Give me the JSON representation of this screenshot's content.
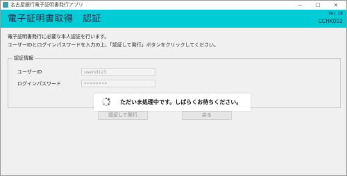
{
  "window": {
    "title": "名古屋銀行電子証明書発行アプリ",
    "controls": {
      "minimize": "─",
      "maximize": "☐",
      "close": "✕"
    }
  },
  "header": {
    "title": "電子証明書取得　認証",
    "version": "Ver. 18",
    "screen_code": "CCHK002",
    "color": "#00ccd6"
  },
  "description": {
    "line1": "電子証明書発行に必要な本人認証を行います。",
    "line2": "ユーザーIDとログインパスワードを入力の上、「認証して発行」ボタンをクリックしてください。"
  },
  "auth_info": {
    "legend": "認証情報",
    "user_id_label": "ユーザーID",
    "user_id_value": "userid123",
    "password_label": "ログインパスワード",
    "password_value": "********"
  },
  "buttons": {
    "authenticate": "認証して発行",
    "back": "戻る"
  },
  "loading": {
    "message": "ただいま処理中です。しばらくお待ちください。",
    "icon": "loading-spinner"
  }
}
